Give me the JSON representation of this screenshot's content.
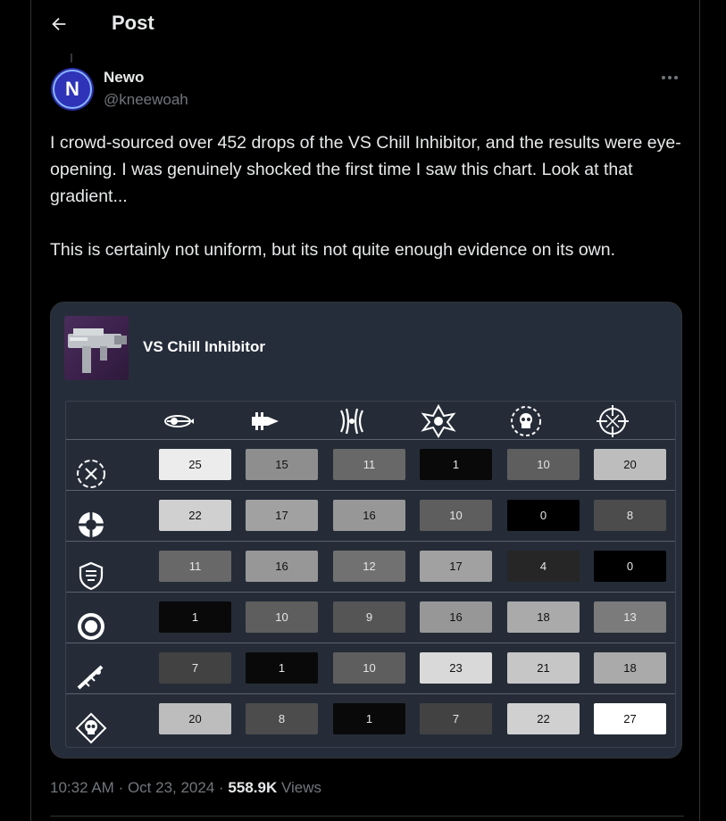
{
  "header": {
    "title": "Post"
  },
  "author": {
    "name": "Newo",
    "handle": "@kneewoah",
    "avatar_letter": "N"
  },
  "tweet": {
    "paragraphs": [
      "I crowd-sourced over 452 drops of the VS Chill Inhibitor, and the results were eye-opening. I was genuinely shocked the first time I saw this chart. Look at that gradient...",
      "This is certainly not uniform, but its not quite enough evidence on its own."
    ]
  },
  "media": {
    "weapon_name": "VS Chill Inhibitor",
    "column_icons": [
      "ammo-icon",
      "barrel-icon",
      "claw-icon",
      "burst-icon",
      "skull-ring-icon",
      "crosshair-icon"
    ],
    "row_icons": [
      "target-icon",
      "gear-ring-icon",
      "shield-icon",
      "ring-icon",
      "rifle-icon",
      "skull-diamond-icon"
    ],
    "grid": [
      [
        25,
        15,
        11,
        1,
        10,
        20
      ],
      [
        22,
        17,
        16,
        10,
        0,
        8
      ],
      [
        11,
        16,
        12,
        17,
        4,
        0
      ],
      [
        1,
        10,
        9,
        16,
        18,
        13
      ],
      [
        7,
        1,
        10,
        23,
        21,
        18
      ],
      [
        20,
        8,
        1,
        7,
        22,
        27
      ]
    ]
  },
  "footer": {
    "time": "10:32 AM",
    "date": "Oct 23, 2024",
    "views_count": "558.9K",
    "views_label": "Views"
  }
}
